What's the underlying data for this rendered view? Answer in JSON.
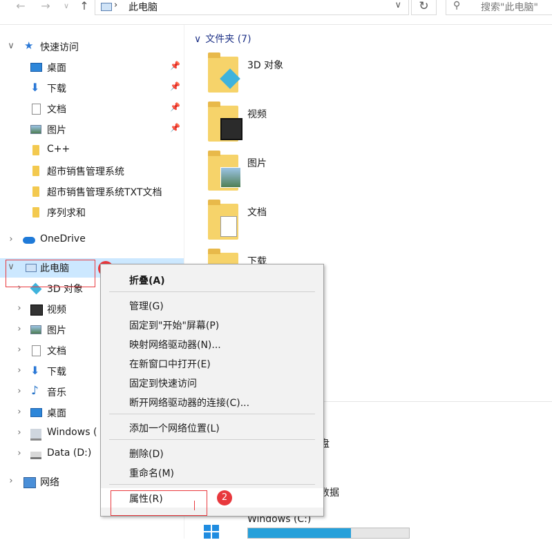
{
  "address": {
    "location": "此电脑",
    "search_placeholder": "搜索\"此电脑\""
  },
  "nav": {
    "quick_access": "快速访问",
    "quick_items": [
      {
        "label": "桌面",
        "icon": "desktop-icon"
      },
      {
        "label": "下载",
        "icon": "download-icon"
      },
      {
        "label": "文档",
        "icon": "document-icon"
      },
      {
        "label": "图片",
        "icon": "picture-icon"
      },
      {
        "label": "C++",
        "icon": "folder-icon"
      },
      {
        "label": "超市销售管理系统",
        "icon": "folder-icon"
      },
      {
        "label": "超市销售管理系统TXT文档",
        "icon": "folder-icon"
      },
      {
        "label": "序列求和",
        "icon": "folder-icon"
      }
    ],
    "onedrive": "OneDrive",
    "this_pc": "此电脑",
    "pc_items": [
      {
        "label": "3D 对象",
        "icon": "3d-objects-icon"
      },
      {
        "label": "视频",
        "icon": "video-icon"
      },
      {
        "label": "图片",
        "icon": "picture-icon"
      },
      {
        "label": "文档",
        "icon": "document-icon"
      },
      {
        "label": "下载",
        "icon": "download-icon"
      },
      {
        "label": "音乐",
        "icon": "music-icon"
      },
      {
        "label": "桌面",
        "icon": "desktop-icon"
      },
      {
        "label": "Windows (",
        "icon": "windows-drive-icon"
      },
      {
        "label": "Data (D:)",
        "icon": "drive-icon"
      }
    ],
    "network": "网络"
  },
  "content": {
    "folders_header": "文件夹 (7)",
    "folders": [
      {
        "label": "3D 对象"
      },
      {
        "label": "视频"
      },
      {
        "label": "图片"
      },
      {
        "label": "文档"
      },
      {
        "label": "下载"
      }
    ],
    "partial_disk": "盘",
    "partial_data": "数据",
    "drive_c": "Windows (C:)"
  },
  "context_menu": {
    "items": [
      "折叠(A)",
      "管理(G)",
      "固定到\"开始\"屏幕(P)",
      "映射网络驱动器(N)...",
      "在新窗口中打开(E)",
      "固定到快速访问",
      "断开网络驱动器的连接(C)...",
      "添加一个网络位置(L)",
      "删除(D)",
      "重命名(M)",
      "属性(R)"
    ]
  },
  "annotations": {
    "badge1": "1",
    "badge2": "2"
  },
  "colors": {
    "accent": "#1e3287",
    "selection": "#cce8ff",
    "badge": "#e8383d",
    "drive_bar": "#26a0da"
  }
}
